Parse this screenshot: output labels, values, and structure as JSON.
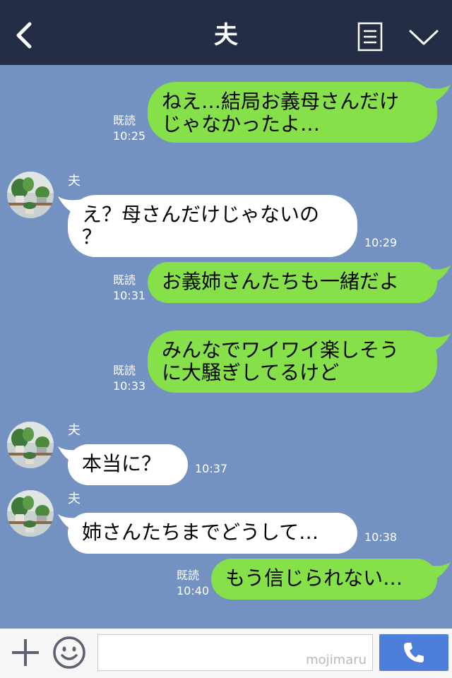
{
  "header": {
    "title": "夫"
  },
  "messages": [
    {
      "side": "out",
      "text": "ねえ…結局お義母さんだけ\nじゃなかったよ…",
      "read": "既読",
      "time": "10:25"
    },
    {
      "side": "in",
      "sender": "夫",
      "text": "え？母さんだけじゃないの\n？",
      "time": "10:29"
    },
    {
      "side": "out",
      "text": "お義姉さんたちも一緒だよ",
      "read": "既読",
      "time": "10:31"
    },
    {
      "side": "out",
      "text": "みんなでワイワイ楽しそう\nに大騒ぎしてるけど",
      "read": "既読",
      "time": "10:33"
    },
    {
      "side": "in",
      "sender": "夫",
      "text": "本当に？",
      "time": "10:37"
    },
    {
      "side": "in",
      "sender": "夫",
      "text": "姉さんたちまでどうして…",
      "time": "10:38"
    },
    {
      "side": "out",
      "text": "もう信じられない…",
      "read": "既読",
      "time": "10:40"
    }
  ],
  "input": {
    "watermark": "mojimaru"
  },
  "colors": {
    "header": "#232d45",
    "background": "#7492c1",
    "outgoing": "#86e04a",
    "incoming": "#ffffff",
    "call": "#4d7ed9"
  },
  "icons": [
    "back-icon",
    "menu-icon",
    "chevron-down-icon",
    "plus-icon",
    "smile-icon",
    "phone-icon"
  ]
}
